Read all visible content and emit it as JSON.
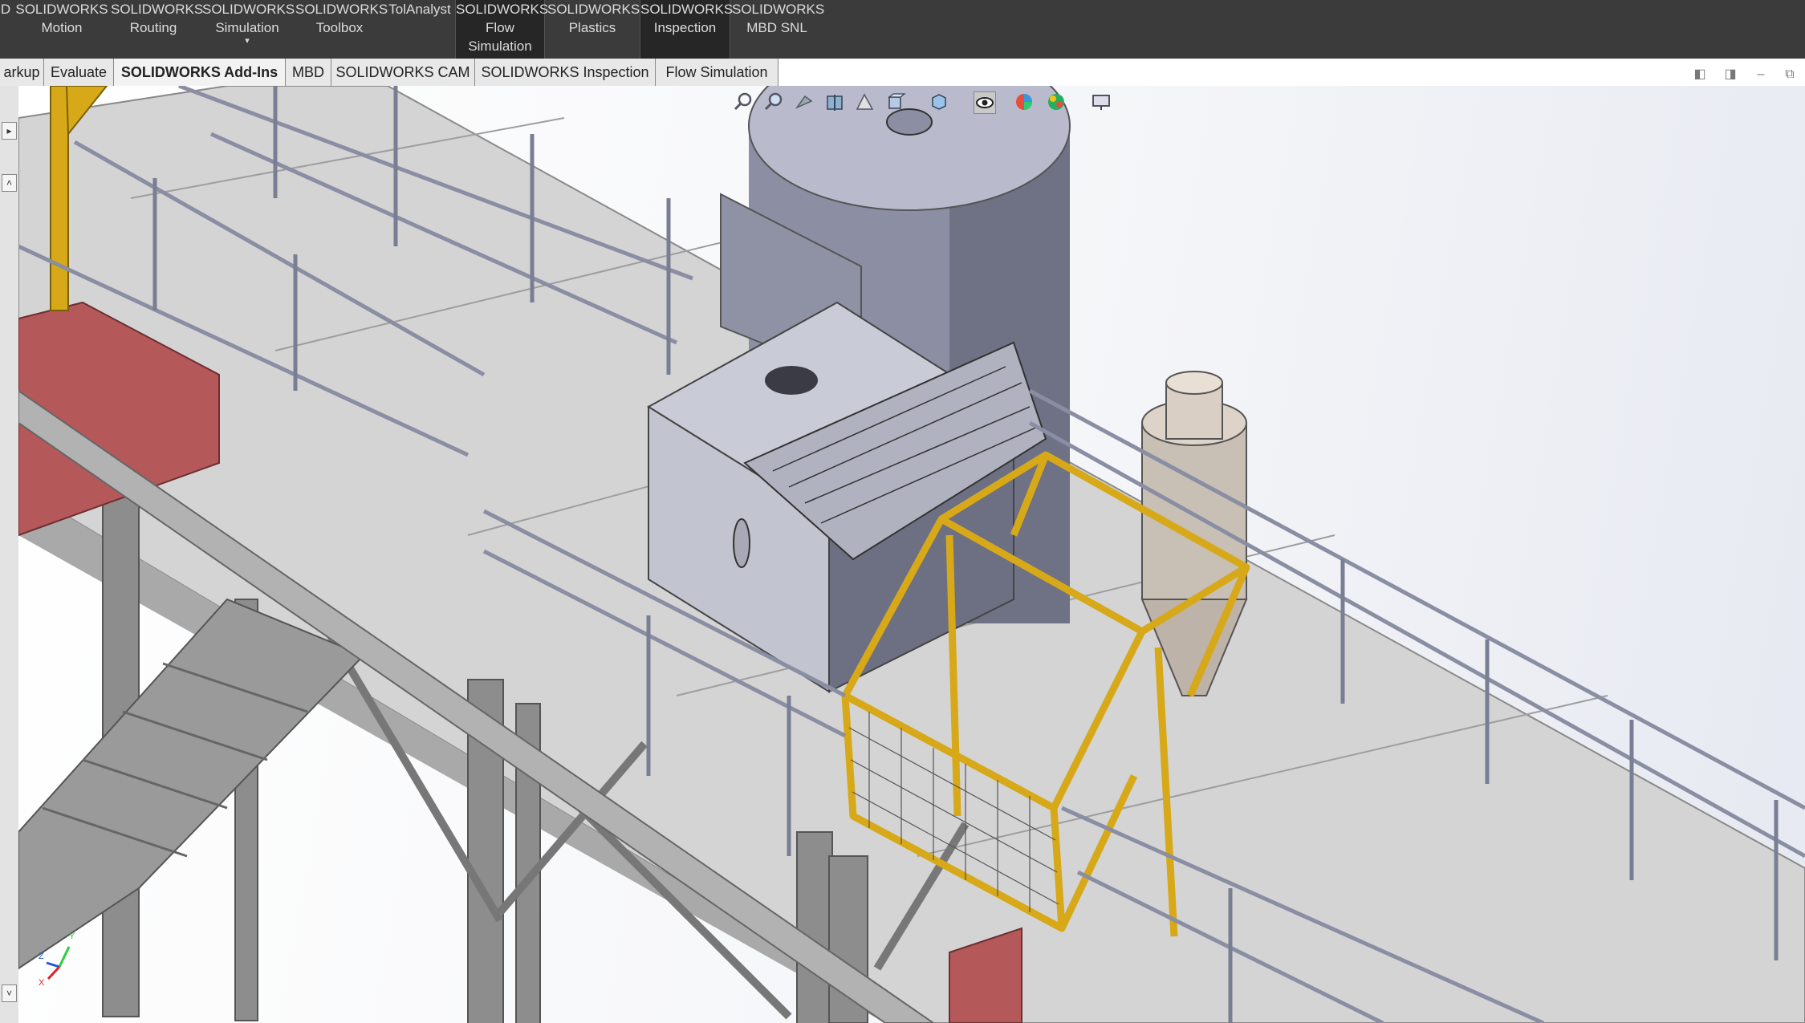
{
  "ribbon": {
    "buttons": [
      {
        "line1": "D",
        "line2": ""
      },
      {
        "line1": "SOLIDWORKS",
        "line2": "Motion"
      },
      {
        "line1": "SOLIDWORKS",
        "line2": "Routing"
      },
      {
        "line1": "SOLIDWORKS",
        "line2": "Simulation",
        "dropdown": "▾"
      },
      {
        "line1": "SOLIDWORKS",
        "line2": "Toolbox"
      },
      {
        "line1": "TolAnalyst",
        "line2": ""
      },
      {
        "line1": "SOLIDWORKS",
        "line2": "Flow",
        "line3": "Simulation"
      },
      {
        "line1": "SOLIDWORKS",
        "line2": "Plastics"
      },
      {
        "line1": "SOLIDWORKS",
        "line2": "Inspection"
      },
      {
        "line1": "SOLIDWORKS",
        "line2": "MBD SNL"
      }
    ]
  },
  "tabs": [
    {
      "label": "arkup"
    },
    {
      "label": "Evaluate"
    },
    {
      "label": "SOLIDWORKS Add-Ins",
      "active": true
    },
    {
      "label": "MBD"
    },
    {
      "label": "SOLIDWORKS CAM"
    },
    {
      "label": "SOLIDWORKS Inspection"
    },
    {
      "label": "Flow Simulation"
    }
  ],
  "heads_up_toolbar": {
    "icons": [
      "zoom-to-fit-icon",
      "zoom-area-icon",
      "previous-view-icon",
      "section-view-icon",
      "dynamic-annotation-icon",
      "view-orientation-icon",
      "display-style-icon",
      "hide-show-items-icon",
      "edit-appearance-icon",
      "apply-scene-icon",
      "view-settings-icon"
    ]
  },
  "window_controls": [
    "restore-left-icon",
    "restore-right-icon",
    "minimize-icon",
    "maximize-icon"
  ],
  "triad": {
    "x": "X",
    "y": "Y",
    "z": "Z"
  },
  "colors": {
    "ribbon_bg": "#3b3b3b",
    "steel_yellow": "#d7a818",
    "deck_grey": "#d4d4d4",
    "tank_blue_grey": "#9a9cb0",
    "red_panel": "#b5585a"
  }
}
